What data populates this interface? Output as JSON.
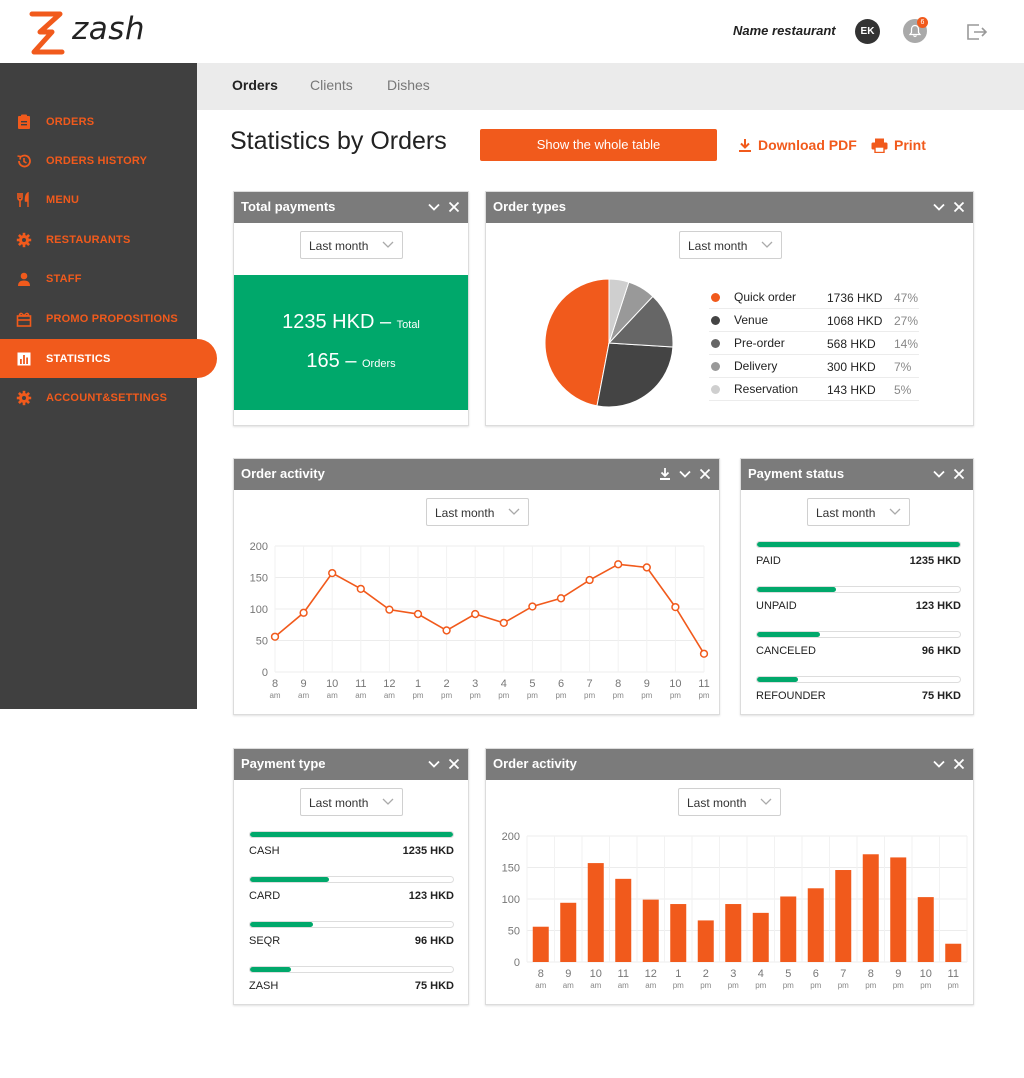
{
  "header": {
    "brand": "zash",
    "restaurant_name": "Name restaurant",
    "user_initials": "EK",
    "notification_count": "6",
    "icons": {
      "bell": "bell-icon",
      "logout": "logout-icon"
    }
  },
  "colors": {
    "accent": "#f15a1c",
    "green": "#00a86b",
    "sidebar": "#404040",
    "widget_header": "#7b7b7b"
  },
  "sidebar": {
    "items": [
      {
        "label": "ORDERS",
        "icon": "clipboard-icon"
      },
      {
        "label": "ORDERS HISTORY",
        "icon": "history-icon"
      },
      {
        "label": "MENU",
        "icon": "fork-knife-icon"
      },
      {
        "label": "RESTAURANTS",
        "icon": "gear-icon"
      },
      {
        "label": "STAFF",
        "icon": "person-icon"
      },
      {
        "label": "PROMO PROPOSITIONS",
        "icon": "gift-icon"
      },
      {
        "label": "STATISTICS",
        "icon": "bar-chart-icon",
        "active": true
      },
      {
        "label": "ACCOUNT&SETTINGS",
        "icon": "gear-icon"
      }
    ]
  },
  "tabs": [
    {
      "label": "Orders",
      "active": true
    },
    {
      "label": "Clients"
    },
    {
      "label": "Dishes"
    }
  ],
  "page": {
    "title": "Statistics by Orders",
    "show_table": "Show the whole table",
    "download_pdf": "Download PDF",
    "print": "Print"
  },
  "total_payments": {
    "title": "Total payments",
    "period": "Last month",
    "amount": "1235 HKD",
    "amount_suffix": "Total",
    "orders": "165",
    "orders_suffix": "Orders",
    "dash": "–"
  },
  "order_types": {
    "title": "Order types",
    "period": "Last month",
    "items": [
      {
        "name": "Quick order",
        "amount": "1736 HKD",
        "pct": "47%",
        "color": "#f15a1c"
      },
      {
        "name": "Venue",
        "amount": "1068 HKD",
        "pct": "27%",
        "color": "#444444"
      },
      {
        "name": "Pre-order",
        "amount": "568 HKD",
        "pct": "14%",
        "color": "#666666"
      },
      {
        "name": "Delivery",
        "amount": "300 HKD",
        "pct": "7%",
        "color": "#999999"
      },
      {
        "name": "Reservation",
        "amount": "143 HKD",
        "pct": "5%",
        "color": "#cfcfcf"
      }
    ]
  },
  "order_activity_line": {
    "title": "Order activity",
    "period": "Last month"
  },
  "payment_status": {
    "title": "Payment status",
    "period": "Last month",
    "items": [
      {
        "label": "PAID",
        "value": "1235 HKD",
        "fraction": 1.0
      },
      {
        "label": "UNPAID",
        "value": "123 HKD",
        "fraction": 0.39
      },
      {
        "label": "CANCELED",
        "value": "96 HKD",
        "fraction": 0.31
      },
      {
        "label": "REFOUNDER",
        "value": "75 HKD",
        "fraction": 0.2
      }
    ]
  },
  "payment_type": {
    "title": "Payment type",
    "period": "Last month",
    "items": [
      {
        "label": "CASH",
        "value": "1235 HKD",
        "fraction": 1.0
      },
      {
        "label": "CARD",
        "value": "123 HKD",
        "fraction": 0.39
      },
      {
        "label": "SEQR",
        "value": "96 HKD",
        "fraction": 0.31
      },
      {
        "label": "ZASH",
        "value": "75 HKD",
        "fraction": 0.2
      }
    ]
  },
  "order_activity_bar": {
    "title": "Order activity",
    "period": "Last month"
  },
  "chart_data": [
    {
      "type": "pie",
      "categories": [
        "Quick order",
        "Venue",
        "Pre-order",
        "Delivery",
        "Reservation"
      ],
      "values": [
        47,
        27,
        14,
        7,
        5
      ]
    },
    {
      "type": "line",
      "categories": [
        "8",
        "9",
        "10",
        "11",
        "12",
        "1",
        "2",
        "3",
        "4",
        "5",
        "6",
        "7",
        "8",
        "9",
        "10",
        "11"
      ],
      "sublabels": [
        "am",
        "am",
        "am",
        "am",
        "am",
        "pm",
        "pm",
        "pm",
        "pm",
        "pm",
        "pm",
        "pm",
        "pm",
        "pm",
        "pm",
        "pm"
      ],
      "values": [
        56,
        94,
        157,
        132,
        99,
        92,
        66,
        92,
        78,
        104,
        117,
        146,
        171,
        166,
        103,
        29
      ],
      "yticks": [
        "0",
        "50",
        "100",
        "150",
        "200"
      ],
      "ylim": [
        0,
        200
      ],
      "grid": true
    },
    {
      "type": "bar",
      "categories": [
        "8",
        "9",
        "10",
        "11",
        "12",
        "1",
        "2",
        "3",
        "4",
        "5",
        "6",
        "7",
        "8",
        "9",
        "10",
        "11"
      ],
      "sublabels": [
        "am",
        "am",
        "am",
        "am",
        "am",
        "pm",
        "pm",
        "pm",
        "pm",
        "pm",
        "pm",
        "pm",
        "pm",
        "pm",
        "pm",
        "pm"
      ],
      "values": [
        56,
        94,
        157,
        132,
        99,
        92,
        66,
        92,
        78,
        104,
        117,
        146,
        171,
        166,
        103,
        29
      ],
      "yticks": [
        "0",
        "50",
        "100",
        "150",
        "200"
      ],
      "ylim": [
        0,
        200
      ],
      "grid": true
    }
  ]
}
